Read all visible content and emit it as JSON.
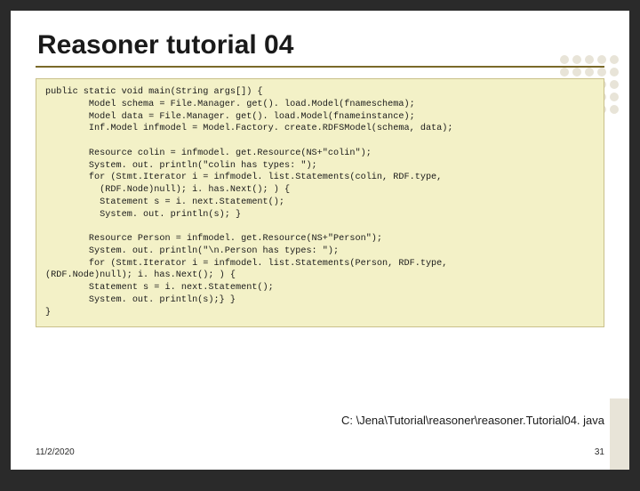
{
  "slide": {
    "title": "Reasoner tutorial 04",
    "code": "public static void main(String args[]) {\n        Model schema = File.Manager. get(). load.Model(fnameschema);\n        Model data = File.Manager. get(). load.Model(fnameinstance);\n        Inf.Model infmodel = Model.Factory. create.RDFSModel(schema, data);\n\n        Resource colin = infmodel. get.Resource(NS+\"colin\");\n        System. out. println(\"colin has types: \");\n        for (Stmt.Iterator i = infmodel. list.Statements(colin, RDF.type,\n          (RDF.Node)null); i. has.Next(); ) {\n          Statement s = i. next.Statement();\n          System. out. println(s); }\n\n        Resource Person = infmodel. get.Resource(NS+\"Person\");\n        System. out. println(\"\\n.Person has types: \");\n        for (Stmt.Iterator i = infmodel. list.Statements(Person, RDF.type,\n(RDF.Node)null); i. has.Next(); ) {\n        Statement s = i. next.Statement();\n        System. out. println(s);} }\n}",
    "filepath": "C: \\Jena\\Tutorial\\reasoner\\reasoner.Tutorial04. java",
    "date": "11/2/2020",
    "page_number": "31"
  }
}
